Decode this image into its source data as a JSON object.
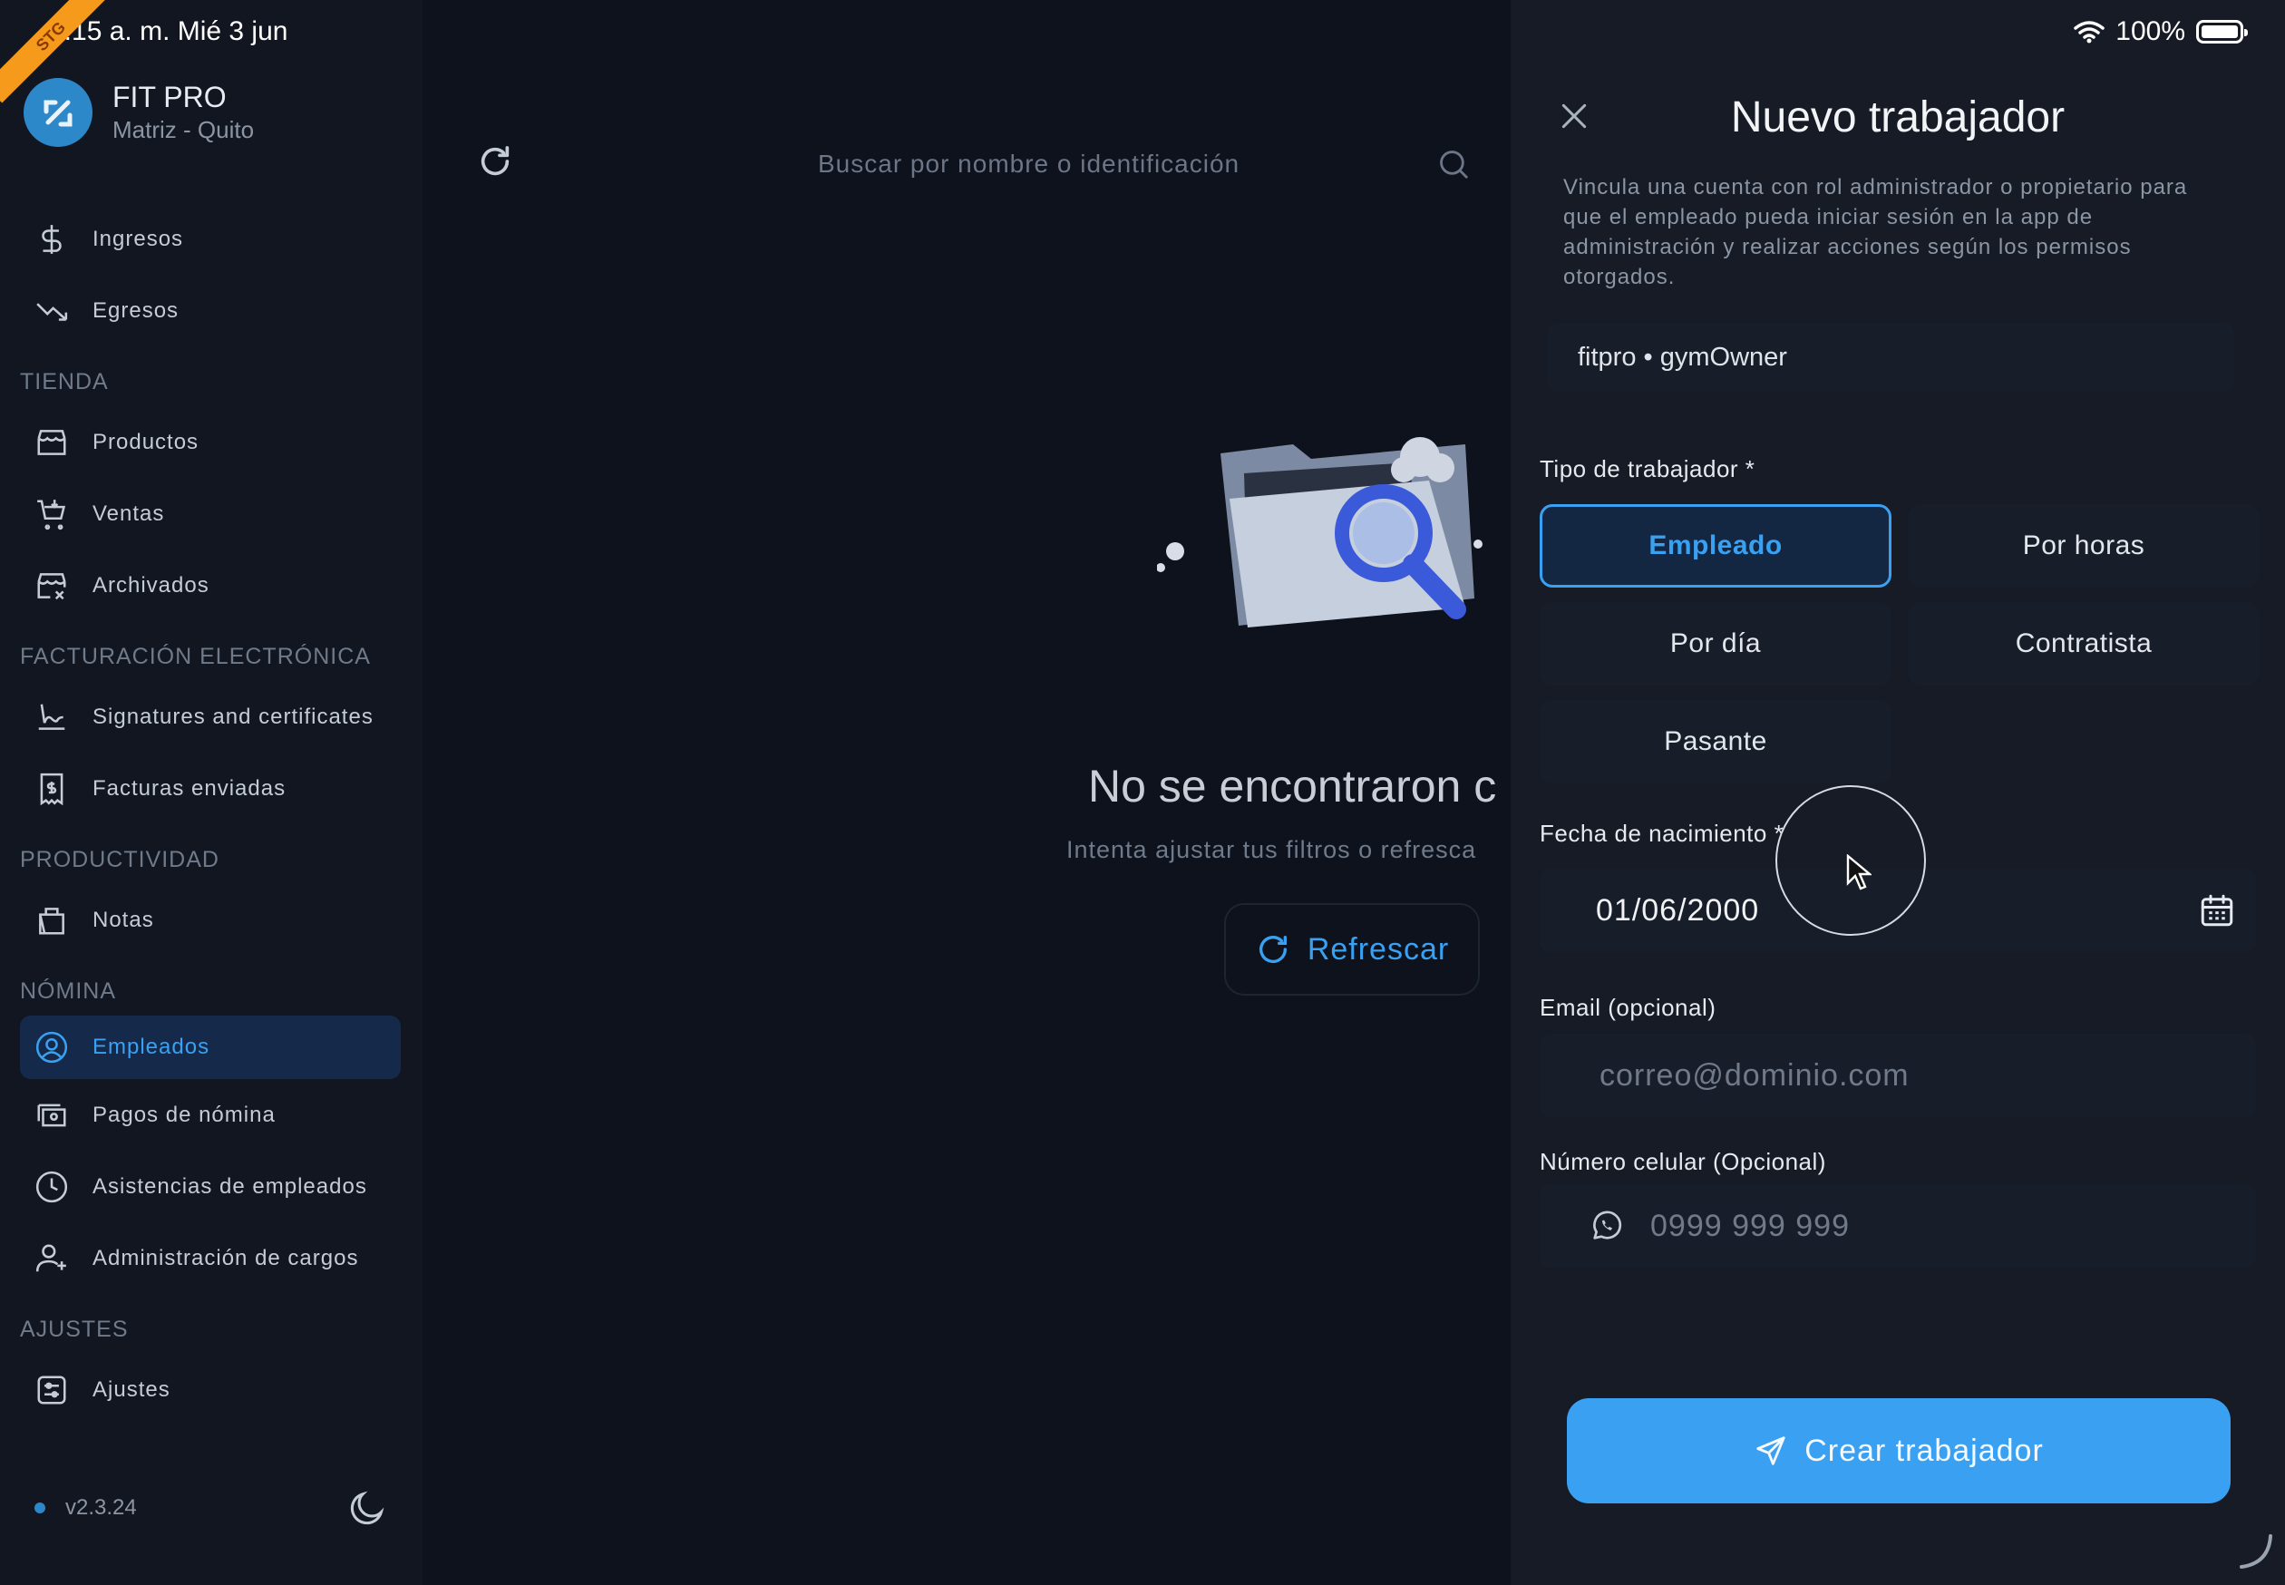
{
  "status_bar": {
    "time": "6:15 a. m.  Mié 3 jun",
    "battery": "100%",
    "ribbon": "STG"
  },
  "brand": {
    "name": "FIT PRO",
    "branch": "Matriz - Quito"
  },
  "sidebar": {
    "items_top": [
      {
        "label": "Ingresos",
        "icon": "dollar-icon"
      },
      {
        "label": "Egresos",
        "icon": "trending-down-icon"
      }
    ],
    "sections": [
      {
        "title": "TIENDA",
        "items": [
          {
            "label": "Productos",
            "icon": "store-icon"
          },
          {
            "label": "Ventas",
            "icon": "cart-icon"
          },
          {
            "label": "Archivados",
            "icon": "archived-store-icon"
          }
        ]
      },
      {
        "title": "FACTURACIÓN ELECTRÓNICA",
        "items": [
          {
            "label": "Signatures and certificates",
            "icon": "signature-icon"
          },
          {
            "label": "Facturas enviadas",
            "icon": "receipt-icon"
          }
        ]
      },
      {
        "title": "PRODUCTIVIDAD",
        "items": [
          {
            "label": "Notas",
            "icon": "notes-icon"
          }
        ]
      },
      {
        "title": "NÓMINA",
        "items": [
          {
            "label": "Empleados",
            "icon": "user-circle-icon",
            "active": true
          },
          {
            "label": "Pagos de nómina",
            "icon": "payment-icon"
          },
          {
            "label": "Asistencias de empleados",
            "icon": "clock-icon"
          },
          {
            "label": "Administración de cargos",
            "icon": "user-plus-icon"
          }
        ]
      },
      {
        "title": "AJUSTES",
        "items": [
          {
            "label": "Ajustes",
            "icon": "settings-sliders-icon"
          }
        ]
      }
    ],
    "version": "v2.3.24"
  },
  "main": {
    "search_placeholder": "Buscar por nombre o identificación",
    "empty_title": "No se encontraron c",
    "empty_subtitle": "Intenta ajustar tus filtros o refresca",
    "refresh_label": "Refrescar"
  },
  "drawer": {
    "title": "Nuevo trabajador",
    "description": "Vincula una cuenta con rol administrador o propietario para que el empleado pueda iniciar sesión en la app de administración y realizar acciones según los permisos otorgados.",
    "account": "fitpro • gymOwner",
    "type_label": "Tipo de trabajador *",
    "types": [
      {
        "label": "Empleado",
        "selected": true
      },
      {
        "label": "Por horas",
        "selected": false
      },
      {
        "label": "Por día",
        "selected": false
      },
      {
        "label": "Contratista",
        "selected": false
      },
      {
        "label": "Pasante",
        "selected": false
      }
    ],
    "birth_label": "Fecha de nacimiento *",
    "birth_value": "01/06/2000",
    "email_label": "Email (opcional)",
    "email_placeholder": "correo@dominio.com",
    "phone_label": "Número celular (Opcional)",
    "phone_placeholder": "0999 999 999",
    "submit_label": "Crear trabajador"
  },
  "colors": {
    "accent": "#3aa1f2",
    "background": "#0c1019",
    "drawer": "#161b25",
    "ribbon": "#f59a1b"
  }
}
